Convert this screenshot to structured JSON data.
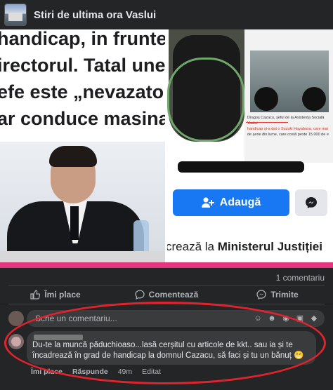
{
  "header": {
    "title": "Stiri de ultima ora Vaslui"
  },
  "image": {
    "headline_lines": [
      "handicap, in frunte cu",
      "irectorul. Tatal unei",
      "efe este „nevazator",
      "ar conduce masina"
    ],
    "right_caption": "Dragoș Cazacu, șeful de la Asistența Socială Vaslui",
    "right_caption_2": "handicap și-a dat o Suzuki Hayabusa, care mai",
    "right_caption_3": "de șerie din lume, care costă peste 15.000 de e",
    "add_button": "Adaugă",
    "bottom_caption_prefix": "crează la ",
    "bottom_caption_bold": "Ministerul Justiției"
  },
  "stats": {
    "comments": "1 comentariu"
  },
  "actions": {
    "like": "Îmi place",
    "comment": "Comentează",
    "share": "Trimite"
  },
  "composer": {
    "placeholder": "Scrie un comentariu..."
  },
  "comment": {
    "text": "Du-te la muncă păduchioaso...lasă cerșitul cu articole de kkt.. sau ia și te încadrează în grad de handicap la domnul Cazacu, să faci și tu un bănuț 😁",
    "like": "Îmi place",
    "reply": "Răspunde",
    "time": "49m",
    "edited": "Editat"
  },
  "colors": {
    "pink_bar": "#e6357e",
    "facebook_blue": "#1877f2",
    "annotation_red": "#e0232d"
  }
}
